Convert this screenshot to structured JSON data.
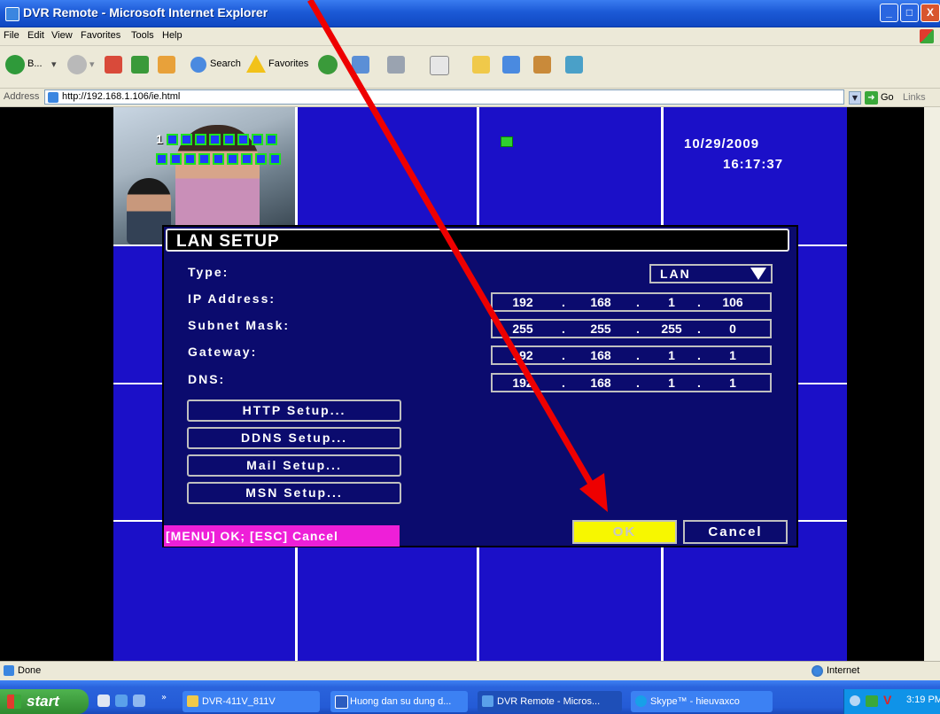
{
  "window": {
    "title": "DVR Remote - Microsoft Internet Explorer",
    "controls": [
      "_",
      "□",
      "X"
    ]
  },
  "menu": [
    "File",
    "Edit",
    "View",
    "Favorites",
    "Tools",
    "Help"
  ],
  "toolbar": {
    "back_label": "B...",
    "search_label": "Search",
    "favorites_label": "Favorites"
  },
  "address": {
    "label": "Address",
    "url": "http://192.168.1.106/ie.html",
    "go_label": "Go",
    "links_label": "Links"
  },
  "dvr": {
    "camera_number": "1",
    "date": "10/29/2009",
    "time": "16:17:37"
  },
  "lan_setup": {
    "title": "LAN SETUP",
    "fields": [
      {
        "label": "Type:",
        "value": "LAN"
      },
      {
        "label": "IP Address:",
        "octets": [
          "192",
          "168",
          "1",
          "106"
        ]
      },
      {
        "label": "Subnet Mask:",
        "octets": [
          "255",
          "255",
          "255",
          "0"
        ]
      },
      {
        "label": "Gateway:",
        "octets": [
          "192",
          "168",
          "1",
          "1"
        ]
      },
      {
        "label": "DNS:",
        "octets": [
          "192",
          "168",
          "1",
          "1"
        ]
      }
    ],
    "buttons": [
      "HTTP Setup...",
      "DDNS Setup...",
      "Mail Setup...",
      "MSN Setup..."
    ],
    "hint": "[MENU] OK; [ESC] Cancel",
    "ok_label": "OK",
    "cancel_label": "Cancel"
  },
  "status": {
    "text": "Done",
    "zone": "Internet"
  },
  "taskbar": {
    "start_label": "start",
    "tasks": [
      "DVR-411V_811V",
      "Huong dan su dung d...",
      "DVR Remote - Micros...",
      "Skype™ - hieuvaxco"
    ],
    "clock": "3:19 PM"
  },
  "colors": {
    "dvr_blue": "#1b10c8",
    "dialog_bg": "#0b0b6e",
    "hint_magenta": "#ee1fd8",
    "ok_yellow": "#f7f700",
    "annotation_arrow": "#ee0000"
  }
}
